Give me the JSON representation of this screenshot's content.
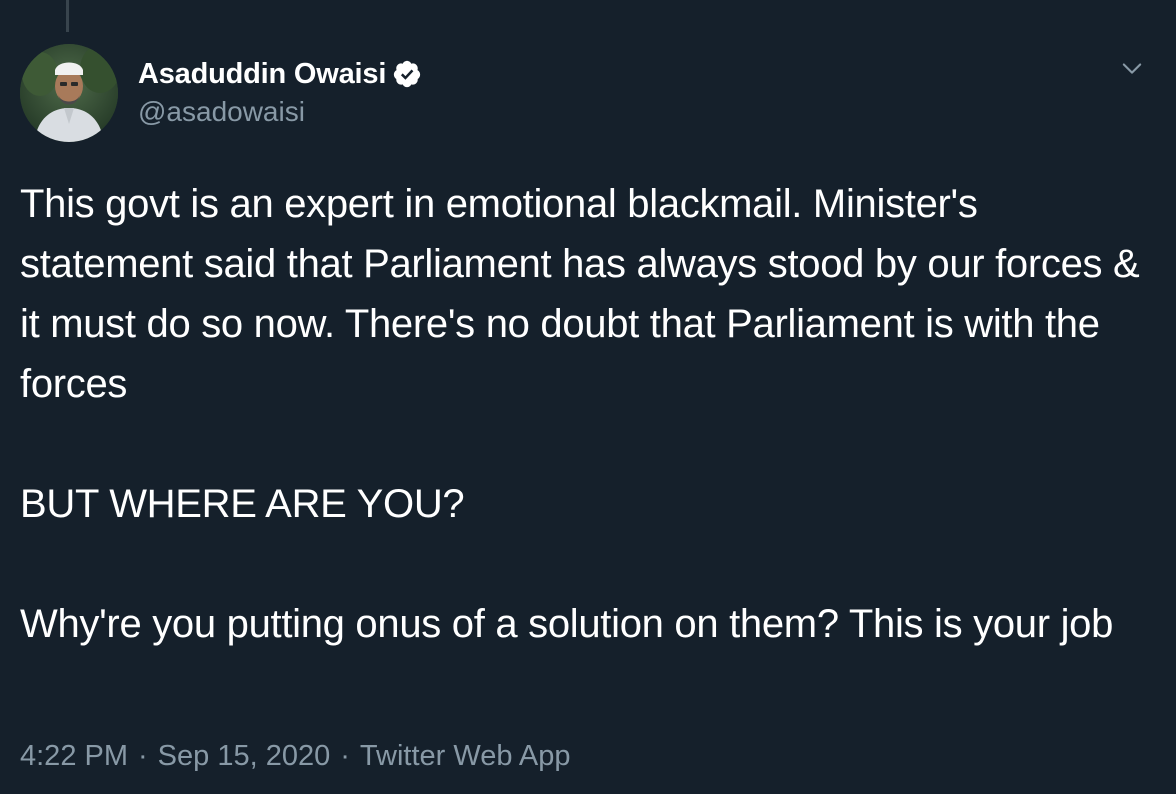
{
  "author": {
    "display_name": "Asaduddin Owaisi",
    "handle": "@asadowaisi",
    "verified": true,
    "avatar_icon": "profile-photo"
  },
  "tweet": {
    "paragraphs": [
      "This govt is an expert in emotional blackmail. Minister's statement said that Parliament has always stood by our forces & it must do so now. There's no doubt that Parliament is with the forces",
      "BUT WHERE ARE YOU?",
      "Why're you putting onus of a solution on them? This is your job"
    ]
  },
  "meta": {
    "time": "4:22 PM",
    "separator": "·",
    "date": "Sep 15, 2020",
    "source": "Twitter Web App"
  },
  "colors": {
    "background": "#15202b",
    "text_primary": "#ffffff",
    "text_secondary": "#8899a6",
    "accent": "#1da1f2"
  }
}
